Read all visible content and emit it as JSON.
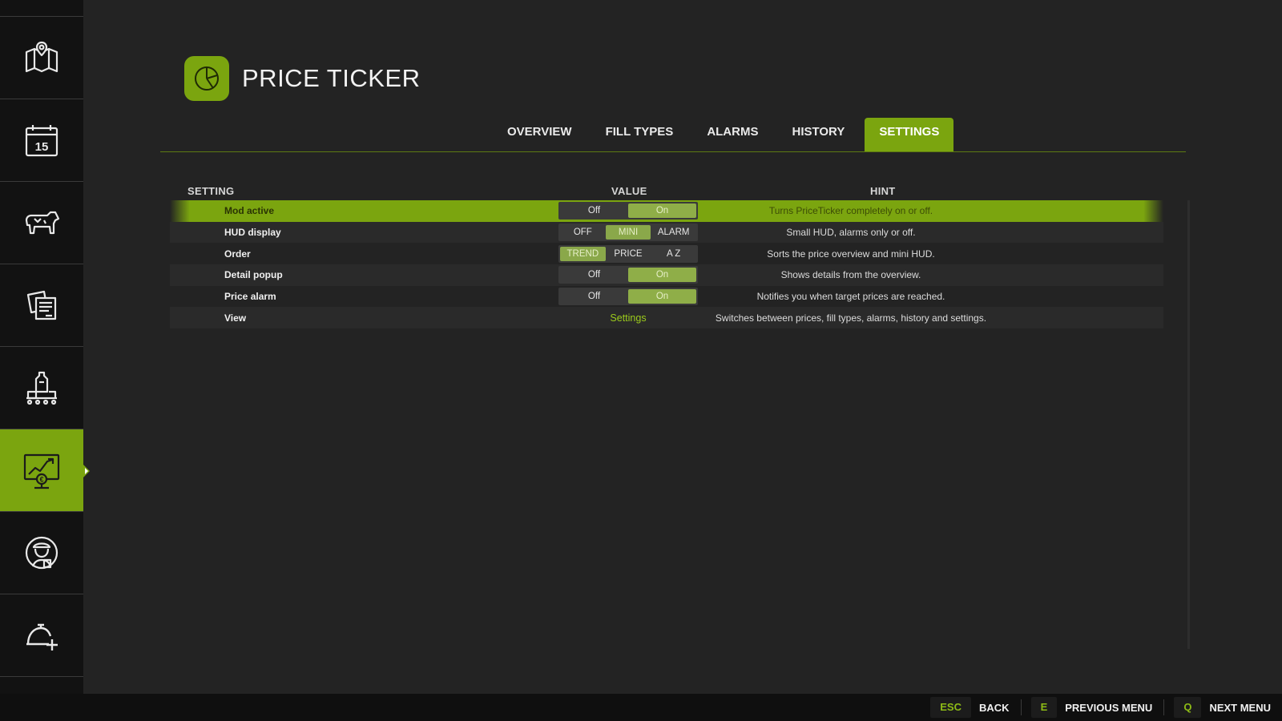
{
  "app": {
    "title": "PRICE TICKER"
  },
  "sidebar": {
    "items": [
      {
        "icon": "map-icon",
        "active": false
      },
      {
        "icon": "calendar-icon",
        "day": "15",
        "active": false
      },
      {
        "icon": "cow-icon",
        "active": false
      },
      {
        "icon": "contracts-icon",
        "active": false
      },
      {
        "icon": "production-icon",
        "active": false
      },
      {
        "icon": "price-chart-icon",
        "active": true
      },
      {
        "icon": "farmer-icon",
        "active": false
      },
      {
        "icon": "help-icon",
        "active": false
      }
    ]
  },
  "tabs": [
    {
      "label": "OVERVIEW",
      "active": false
    },
    {
      "label": "FILL TYPES",
      "active": false
    },
    {
      "label": "ALARMS",
      "active": false
    },
    {
      "label": "HISTORY",
      "active": false
    },
    {
      "label": "SETTINGS",
      "active": true
    }
  ],
  "table": {
    "headers": {
      "setting": "SETTING",
      "value": "VALUE",
      "hint": "HINT"
    },
    "rows": [
      {
        "name": "Mod active",
        "options": [
          "Off",
          "On"
        ],
        "selected": "On",
        "hint": "Turns PriceTicker completely on or off."
      },
      {
        "name": "HUD display",
        "options": [
          "OFF",
          "MINI",
          "ALARM"
        ],
        "selected": "MINI",
        "hint": "Small HUD, alarms only or off."
      },
      {
        "name": "Order",
        "options": [
          "TREND",
          "PRICE",
          "A Z"
        ],
        "selected": "TREND",
        "hint": "Sorts the price overview and mini HUD."
      },
      {
        "name": "Detail popup",
        "options": [
          "Off",
          "On"
        ],
        "selected": "On",
        "hint": "Shows details from the overview."
      },
      {
        "name": "Price alarm",
        "options": [
          "Off",
          "On"
        ],
        "selected": "On",
        "hint": "Notifies you when target prices are reached."
      },
      {
        "name": "View",
        "value": "Settings",
        "hint": "Switches between prices, fill types, alarms, history and settings."
      }
    ]
  },
  "footer": {
    "hotkeys": [
      {
        "key": "ESC",
        "label": "BACK"
      },
      {
        "key": "E",
        "label": "PREVIOUS MENU"
      },
      {
        "key": "Q",
        "label": "NEXT MENU"
      }
    ]
  },
  "colors": {
    "accent": "#7ba50f",
    "background": "#232323",
    "sidebar": "#121212"
  }
}
